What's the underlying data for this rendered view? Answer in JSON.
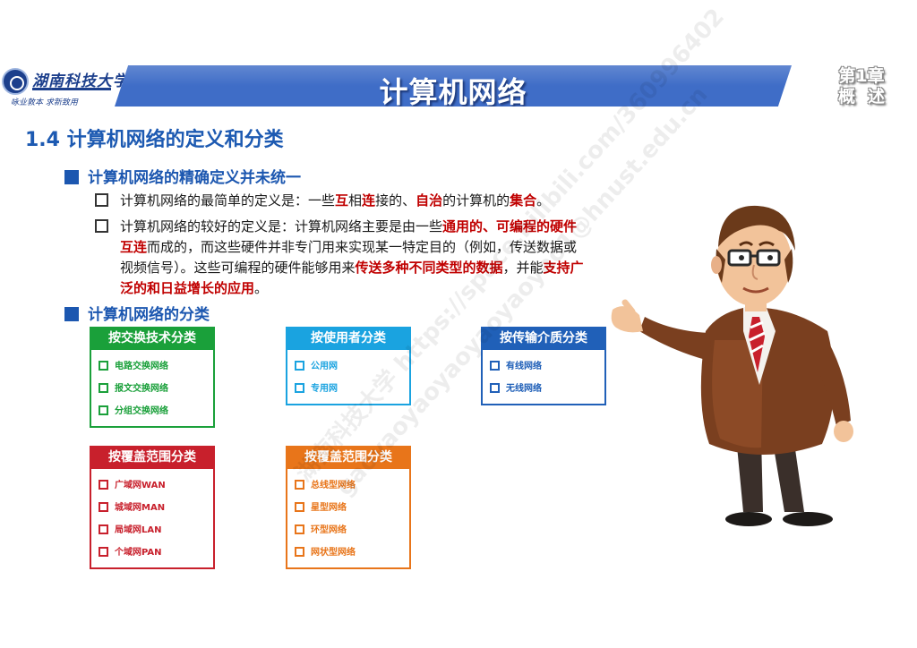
{
  "header": {
    "logo_name": "湖南科技大学",
    "logo_motto": "咏业敦本  求新致用",
    "title": "计算机网络",
    "chapter_num": "第1章",
    "chapter_name": "概述"
  },
  "section": {
    "heading": "1.4 计算机网络的定义和分类"
  },
  "definition": {
    "heading": "计算机网络的精确定义并未统一",
    "item1": [
      {
        "t": "计算机网络的最简单的定义是：一些",
        "red": false
      },
      {
        "t": "互",
        "red": true
      },
      {
        "t": "相",
        "red": false
      },
      {
        "t": "连",
        "red": true
      },
      {
        "t": "接的、",
        "red": false
      },
      {
        "t": "自治",
        "red": true
      },
      {
        "t": "的计算机的",
        "red": false
      },
      {
        "t": "集合",
        "red": true
      },
      {
        "t": "。",
        "red": false
      }
    ],
    "item2": [
      {
        "t": "计算机网络的较好的定义是：计算机网络主要是由一些",
        "red": false
      },
      {
        "t": "通用的、可编程的硬件互连",
        "red": true
      },
      {
        "t": "而成的，而这些硬件并非专门用来实现某一特定目的（例如，传送数据或视频信号）。这些可编程的硬件能够用来",
        "red": false
      },
      {
        "t": "传送多种不同类型的数据",
        "red": true
      },
      {
        "t": "，并能",
        "red": false
      },
      {
        "t": "支持广泛的和日益增长的应用",
        "red": true
      },
      {
        "t": "。",
        "red": false
      }
    ]
  },
  "classification": {
    "heading": "计算机网络的分类",
    "boxes": [
      {
        "title": "按交换技术分类",
        "color": "#1aa03a",
        "items": [
          "电路交换网络",
          "报文交换网络",
          "分组交换网络"
        ]
      },
      {
        "title": "按使用者分类",
        "color": "#1aa3e0",
        "items": [
          "公用网",
          "专用网"
        ]
      },
      {
        "title": "按传输介质分类",
        "color": "#2060b8",
        "items": [
          "有线网络",
          "无线网络"
        ]
      },
      {
        "title": "按覆盖范围分类",
        "color": "#c8202c",
        "items": [
          "广域网WAN",
          "城域网MAN",
          "局域网LAN",
          "个域网PAN"
        ]
      },
      {
        "title": "按覆盖范围分类",
        "color": "#e8751a",
        "items": [
          "总线型网络",
          "星型网络",
          "环型网络",
          "网状型网络"
        ]
      }
    ]
  },
  "watermark": {
    "line1": "湖南科技大学 https://space.bilibili.com/360996402",
    "line2": "gaoyaoyaoyaoyaoyaoyao1@hnust.edu.cn"
  }
}
